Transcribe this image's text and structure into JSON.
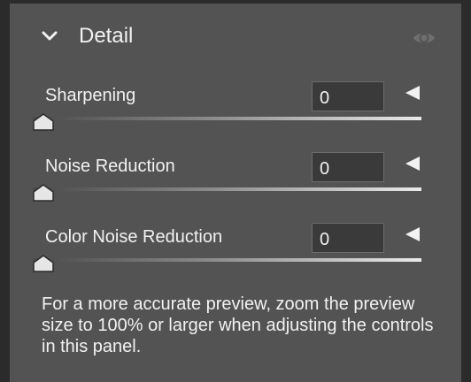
{
  "panel": {
    "title": "Detail",
    "collapse_icon": "chevron-down-icon",
    "visibility_icon": "eye-icon"
  },
  "sliders": [
    {
      "label": "Sharpening",
      "value": "0",
      "slider_position": 0
    },
    {
      "label": "Noise Reduction",
      "value": "0",
      "slider_position": 0
    },
    {
      "label": "Color Noise Reduction",
      "value": "0",
      "slider_position": 0
    }
  ],
  "info_text": "For a more accurate preview, zoom the preview size to 100% or larger when adjusting the controls in this panel."
}
